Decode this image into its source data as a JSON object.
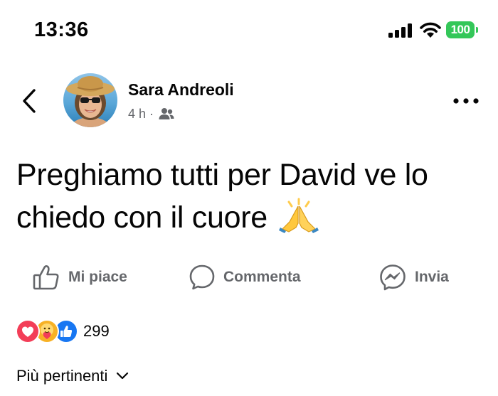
{
  "status_bar": {
    "time": "13:36",
    "battery_level": "100",
    "icons": [
      "signal-icon",
      "wifi-icon",
      "battery-icon"
    ]
  },
  "post": {
    "author": "Sara Andreoli",
    "time_ago": "4 h",
    "separator": "·",
    "audience_icon": "friends-icon",
    "text": "Preghiamo tutti per David ve lo chiedo con il cuore",
    "emoji": "folded-hands-emoji"
  },
  "actions": {
    "like_label": "Mi piace",
    "comment_label": "Commenta",
    "share_label": "Invia"
  },
  "reactions": {
    "types": [
      "love",
      "care",
      "like"
    ],
    "count": "299"
  },
  "comments": {
    "sort_label": "Più pertinenti"
  },
  "colors": {
    "text": "#050505",
    "secondary": "#65676b",
    "like_blue": "#1877f2",
    "love_red": "#f33e58",
    "care_yellow": "#f7b125",
    "battery_green": "#34c759"
  }
}
